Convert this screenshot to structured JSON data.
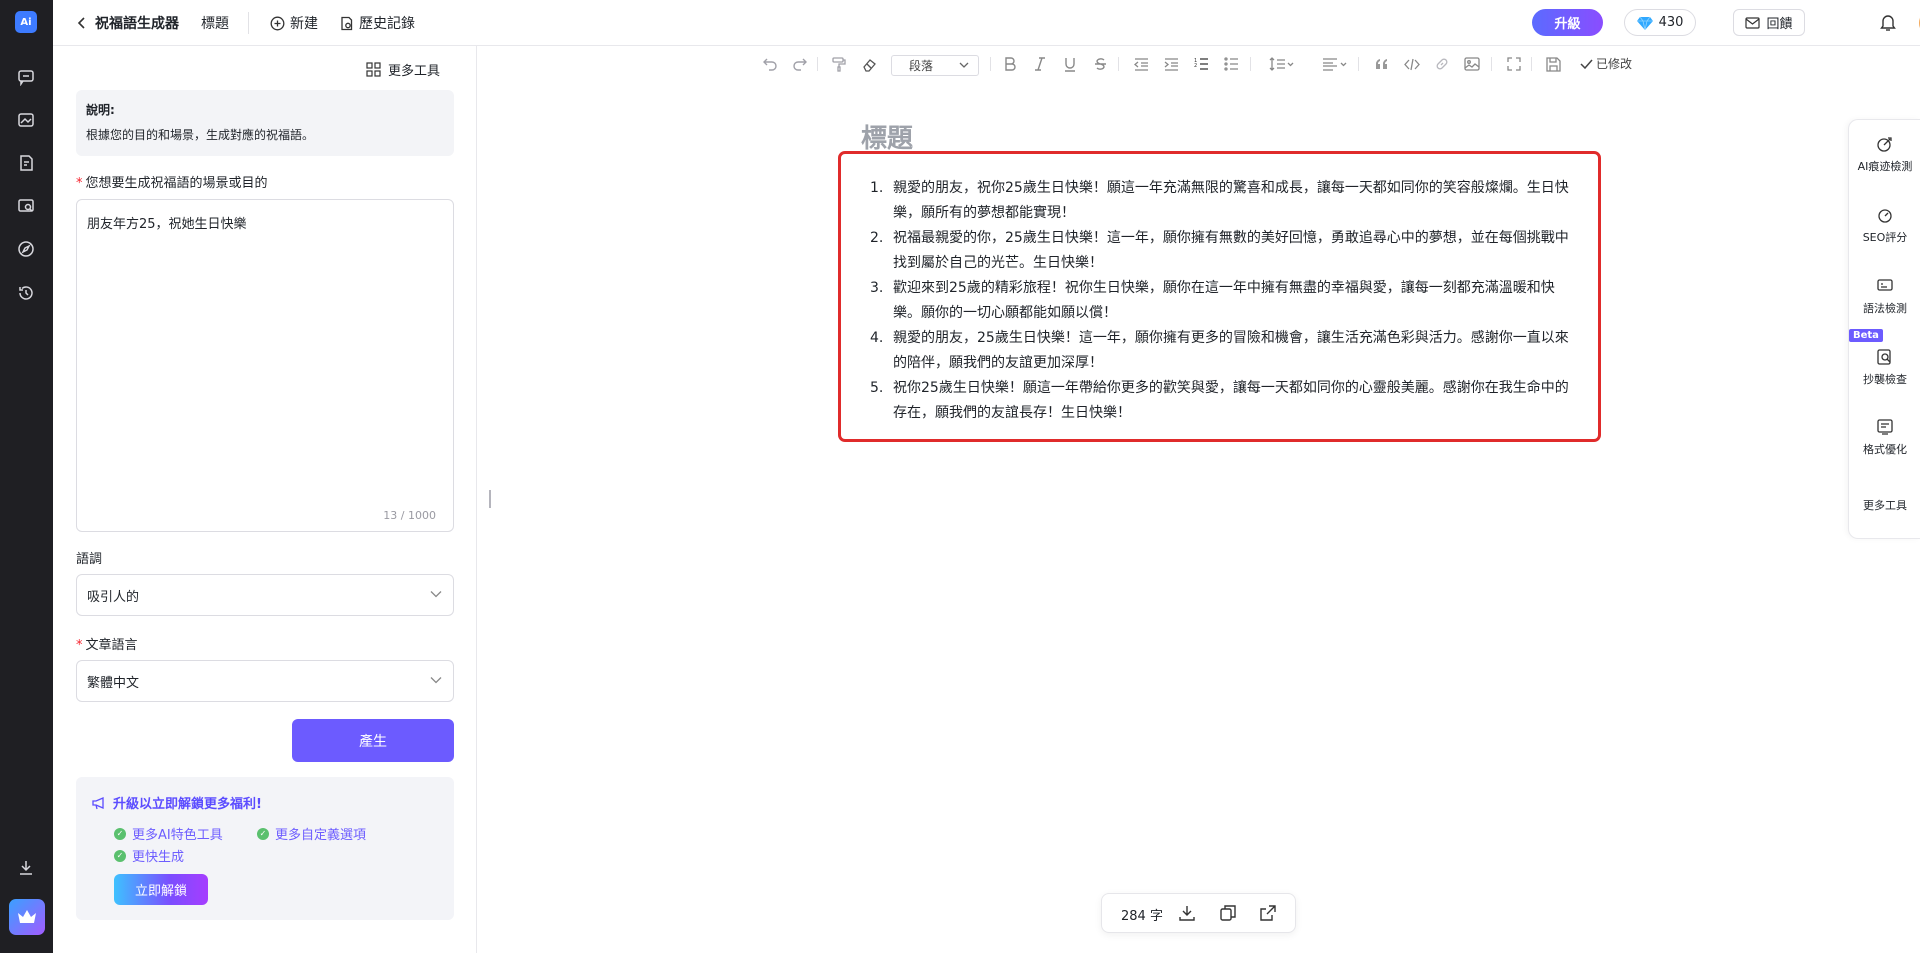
{
  "header": {
    "back_title": "祝福語生成器",
    "doc_tab": "標題",
    "new_label": "新建",
    "history_label": "歷史記錄",
    "upgrade_label": "升級",
    "credits": "430",
    "feedback_label": "回饋"
  },
  "panel": {
    "more_tools": "更多工具",
    "desc_title": "說明:",
    "desc_text": "根據您的目的和場景，生成對應的祝福語。",
    "scene_label": "您想要生成祝福語的場景或目的",
    "scene_value": "朋友年方25，祝她生日快樂",
    "scene_count": "13 / 1000",
    "tone_label": "語調",
    "tone_value": "吸引人的",
    "lang_label": "文章語言",
    "lang_value": "繁體中文",
    "generate_label": "產生",
    "promo_title": "升級以立即解鎖更多福利!",
    "promo_features": [
      "更多AI特色工具",
      "更多自定義選項",
      "更快生成"
    ],
    "unlock_label": "立即解鎖"
  },
  "toolbar": {
    "paragraph_label": "段落",
    "modified_label": "已修改"
  },
  "doc": {
    "title": "標題",
    "items": [
      {
        "num": "1.",
        "text": "親愛的朋友，祝你25歲生日快樂！願這一年充滿無限的驚喜和成長，讓每一天都如同你的笑容般燦爛。生日快樂，願所有的夢想都能實現！"
      },
      {
        "num": "2.",
        "text": "祝福最親愛的你，25歲生日快樂！這一年，願你擁有無數的美好回憶，勇敢追尋心中的夢想，並在每個挑戰中找到屬於自己的光芒。生日快樂！"
      },
      {
        "num": "3.",
        "text": "歡迎來到25歲的精彩旅程！祝你生日快樂，願你在這一年中擁有無盡的幸福與愛，讓每一刻都充滿溫暖和快樂。願你的一切心願都能如願以償！"
      },
      {
        "num": "4.",
        "text": "親愛的朋友，25歲生日快樂！這一年，願你擁有更多的冒險和機會，讓生活充滿色彩與活力。感謝你一直以來的陪伴，願我們的友誼更加深厚！"
      },
      {
        "num": "5.",
        "text": "祝你25歲生日快樂！願這一年帶給你更多的歡笑與愛，讓每一天都如同你的心靈般美麗。感謝你在我生命中的存在，願我們的友誼長存！生日快樂！"
      }
    ]
  },
  "right_sidebar": {
    "items": [
      "AI痕迹檢測",
      "SEO評分",
      "語法檢測",
      "抄襲檢查",
      "格式優化",
      "更多工具"
    ],
    "beta_label": "Beta"
  },
  "wordbar": {
    "count": "284 字"
  },
  "colors": {
    "accent": "#6c5bff",
    "highlight_border": "#e02b2b",
    "rail_bg": "#1f1f23"
  }
}
